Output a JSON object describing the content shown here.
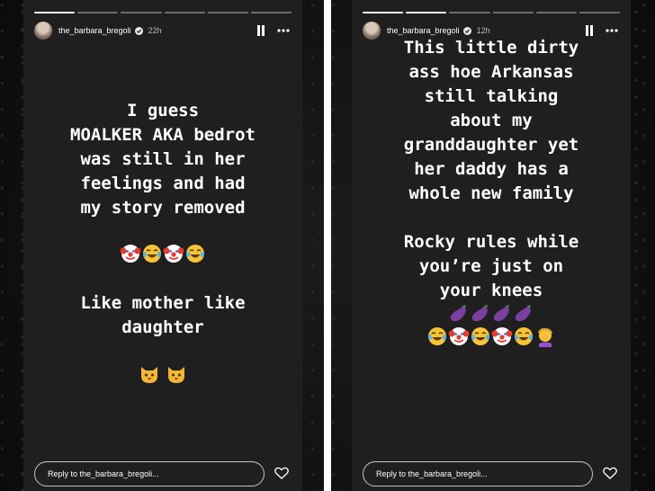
{
  "stories": [
    {
      "username": "the_barbara_bregoli",
      "time": "22h",
      "progress": {
        "completed_segments": 1,
        "total_segments": 6
      },
      "caption_main": "I guess\nMOALKER AKA bedrot\nwas still in her\nfeelings and had\nmy story removed",
      "emoji_row_1": [
        "clown-face-emoji",
        "tears-of-joy-emoji",
        "clown-face-emoji",
        "tears-of-joy-emoji"
      ],
      "caption_secondary": "Like mother like\ndaughter",
      "emoji_row_2": [
        "cat-face-emoji",
        "cat-face-emoji"
      ],
      "reply_placeholder": "Reply to the_barbara_bregoli..."
    },
    {
      "username": "the_barbara_bregoli",
      "time": "12h",
      "progress": {
        "completed_segments": 2,
        "total_segments": 6
      },
      "caption_main": "This little dirty\nass hoe Arkansas\nstill talking\nabout my\ngranddaughter yet\nher daddy has a\nwhole new family\n\nRocky rules while\nyou’re just on\nyour knees",
      "emoji_row_1": [
        "eggplant-emoji",
        "eggplant-emoji",
        "eggplant-emoji",
        "eggplant-emoji"
      ],
      "emoji_row_2": [
        "tears-of-joy-emoji",
        "clown-face-emoji",
        "tears-of-joy-emoji",
        "clown-face-emoji",
        "tears-of-joy-emoji",
        "facepalm-emoji"
      ],
      "reply_placeholder": "Reply to the_barbara_bregoli..."
    }
  ],
  "colors": {
    "story_background": "#1f1f1f",
    "text": "#ffffff",
    "divider": "#ffffff"
  }
}
